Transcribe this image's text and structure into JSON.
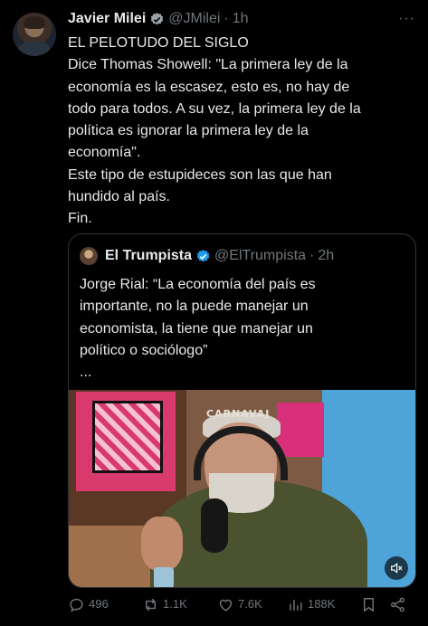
{
  "tweet": {
    "author_name": "Javier Milei",
    "handle": "@JMilei",
    "separator": "·",
    "time": "1h",
    "more": "···",
    "lines": [
      "EL PELOTUDO DEL SIGLO",
      "Dice Thomas Showell: \"La primera ley de la",
      "economía es la escasez, esto es, no hay de",
      "todo para todos. A su vez, la primera ley de la",
      "política es ignorar la primera ley de la",
      "economía\".",
      "Este tipo de estupideces son las que han",
      "hundido al país.",
      "Fin."
    ]
  },
  "quote": {
    "author_name": "El Trumpista",
    "handle": "@ElTrumpista",
    "separator": "·",
    "time": "2h",
    "lines": [
      "Jorge Rial: “La economía del país es",
      "importante, no la puede manejar un",
      "economista, la tiene que manejar un",
      "político o sociólogo”",
      "..."
    ],
    "media_logo": "CARNAVAJ"
  },
  "actions": {
    "replies": "496",
    "reposts": "1.1K",
    "likes": "7.6K",
    "views": "188K"
  },
  "colors": {
    "background": "#000000",
    "text": "#e7e9ea",
    "secondary": "#71767b",
    "verified": "#1d9bf0",
    "border": "#2f3336"
  },
  "icons": [
    "verified-badge-icon",
    "more-icon",
    "mute-icon",
    "reply-icon",
    "repost-icon",
    "like-icon",
    "views-icon",
    "bookmark-icon",
    "share-icon"
  ]
}
